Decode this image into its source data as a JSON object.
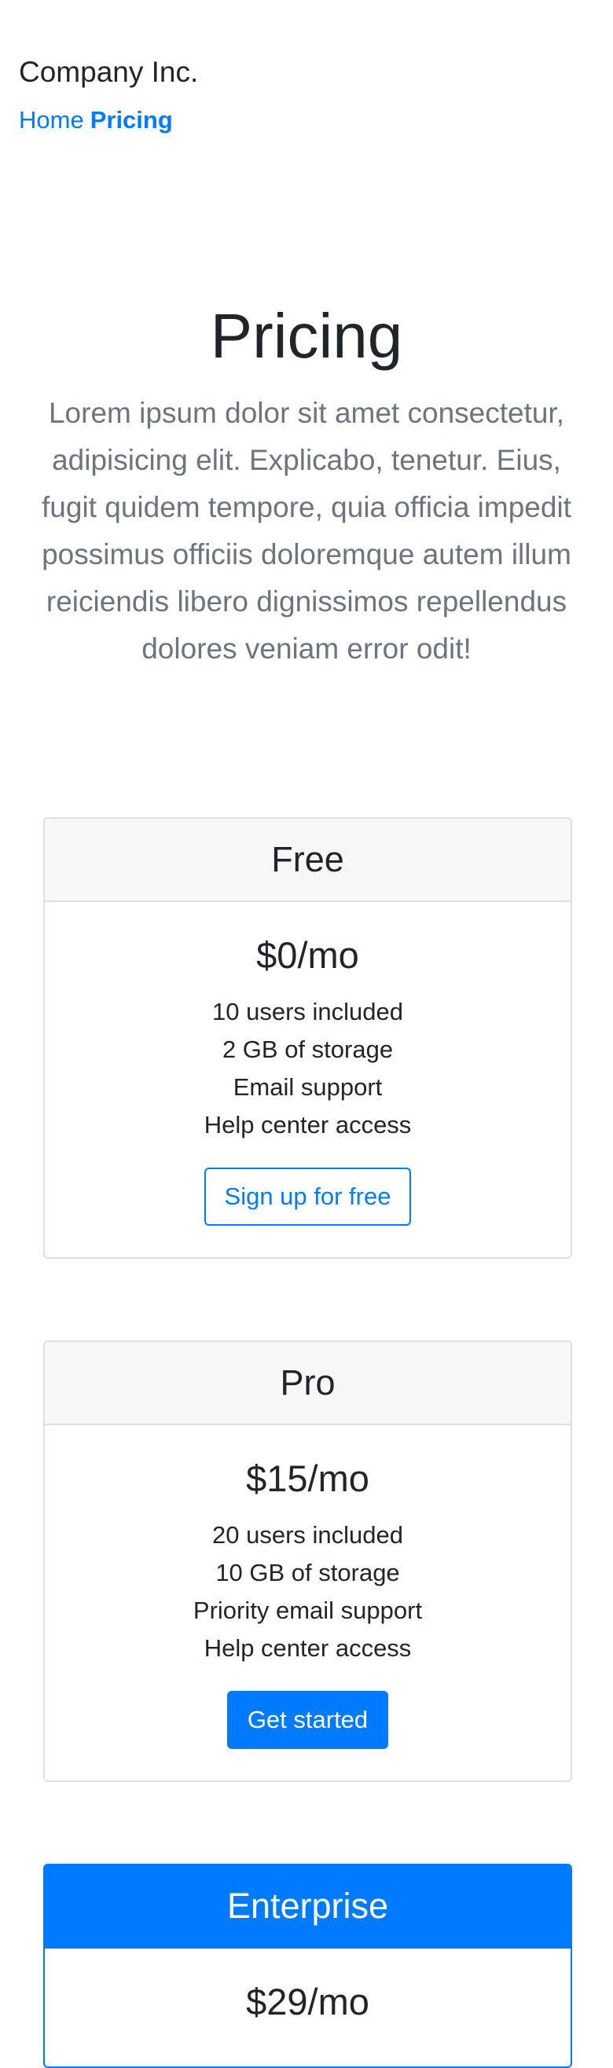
{
  "header": {
    "brand": "Company Inc.",
    "nav": [
      {
        "label": "Home"
      },
      {
        "label": "Pricing"
      }
    ]
  },
  "hero": {
    "title": "Pricing",
    "lead": "Lorem ipsum dolor sit amet consectetur, adipisicing elit. Explicabo, tenetur. Eius, fugit quidem tempore, quia officia impedit possimus officiis doloremque autem illum reiciendis libero dignissimos repellendus dolores veniam error odit!"
  },
  "plans": [
    {
      "name": "Free",
      "price": "$0/mo",
      "features": [
        "10 users included",
        "2 GB of storage",
        "Email support",
        "Help center access"
      ],
      "cta": "Sign up for free"
    },
    {
      "name": "Pro",
      "price": "$15/mo",
      "features": [
        "20 users included",
        "10 GB of storage",
        "Priority email support",
        "Help center access"
      ],
      "cta": "Get started"
    },
    {
      "name": "Enterprise",
      "price": "$29/mo"
    }
  ],
  "colors": {
    "primary": "#007bff",
    "muted": "#6c757d",
    "text": "#212529",
    "card_header_bg": "#f7f7f7",
    "border": "#dfdfdf"
  }
}
